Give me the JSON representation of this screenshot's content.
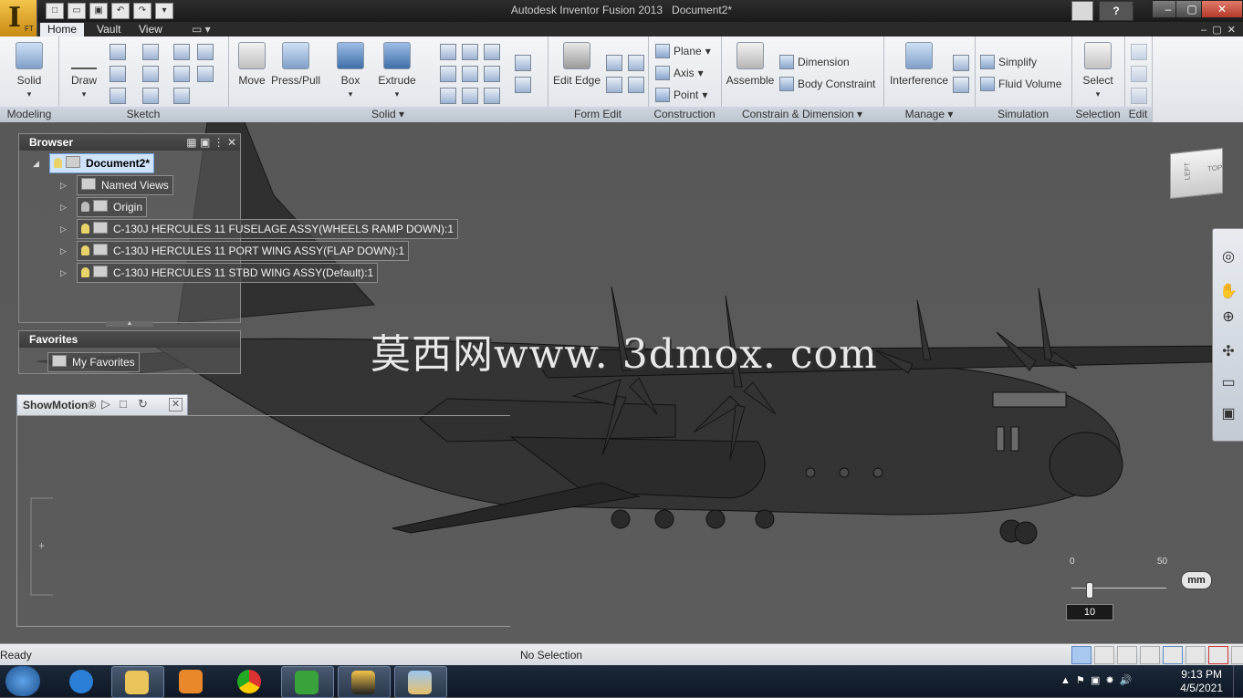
{
  "window": {
    "app_title": "Autodesk Inventor Fusion 2013",
    "document_title": "Document2*",
    "app_button_letter": "I",
    "app_button_sub": "FT"
  },
  "menu_tabs": [
    "Home",
    "Vault",
    "View"
  ],
  "ribbon": {
    "panels": [
      {
        "label": "Modeling",
        "buttons": [
          "Solid"
        ]
      },
      {
        "label": "Sketch",
        "buttons": [
          "Draw"
        ]
      },
      {
        "label": "Solid",
        "buttons": [
          "Move",
          "Press/Pull",
          "Box",
          "Extrude"
        ]
      },
      {
        "label": "Form Edit",
        "buttons": [
          "Edit Edge"
        ]
      },
      {
        "label": "Construction",
        "buttons": [
          "Plane",
          "Axis",
          "Point"
        ]
      },
      {
        "label": "Constrain & Dimension",
        "buttons": [
          "Assemble",
          "Dimension",
          "Body Constraint"
        ]
      },
      {
        "label": "Manage",
        "buttons": [
          "Interference"
        ]
      },
      {
        "label": "Simulation",
        "buttons": [
          "Simplify",
          "Fluid Volume"
        ]
      },
      {
        "label": "Selection",
        "buttons": [
          "Select"
        ]
      },
      {
        "label": "Edit",
        "buttons": []
      }
    ]
  },
  "browser": {
    "title": "Browser",
    "root": "Document2*",
    "items": [
      "Named Views",
      "Origin",
      "C-130J HERCULES 11 FUSELAGE ASSY(WHEELS RAMP DOWN):1",
      "C-130J HERCULES 11 PORT WING ASSY(FLAP DOWN):1",
      "C-130J HERCULES 11 STBD WING ASSY(Default):1"
    ]
  },
  "favorites": {
    "title": "Favorites",
    "item": "My Favorites"
  },
  "showmotion": {
    "title": "ShowMotion®"
  },
  "viewcube": {
    "left_label": "LEFT",
    "top_label": "TOP"
  },
  "watermark": "莫西网www. 3dmox. com",
  "scale": {
    "tick_start": "0",
    "tick_end": "50",
    "unit": "mm",
    "value": "10"
  },
  "status": {
    "left": "Ready",
    "center": "No Selection"
  },
  "taskbar": {
    "time": "9:13 PM",
    "date": "4/5/2021",
    "apps": [
      "start",
      "internet-explorer",
      "file-explorer",
      "media-player",
      "chrome",
      "camtasia",
      "inventor",
      "paint"
    ]
  },
  "colors": {
    "ribbon_bg": "#e4e8ec",
    "viewport_bg": "#5a5a5a",
    "selection_highlight": "#cfe3fb",
    "taskbar_bg": "#14202f"
  }
}
